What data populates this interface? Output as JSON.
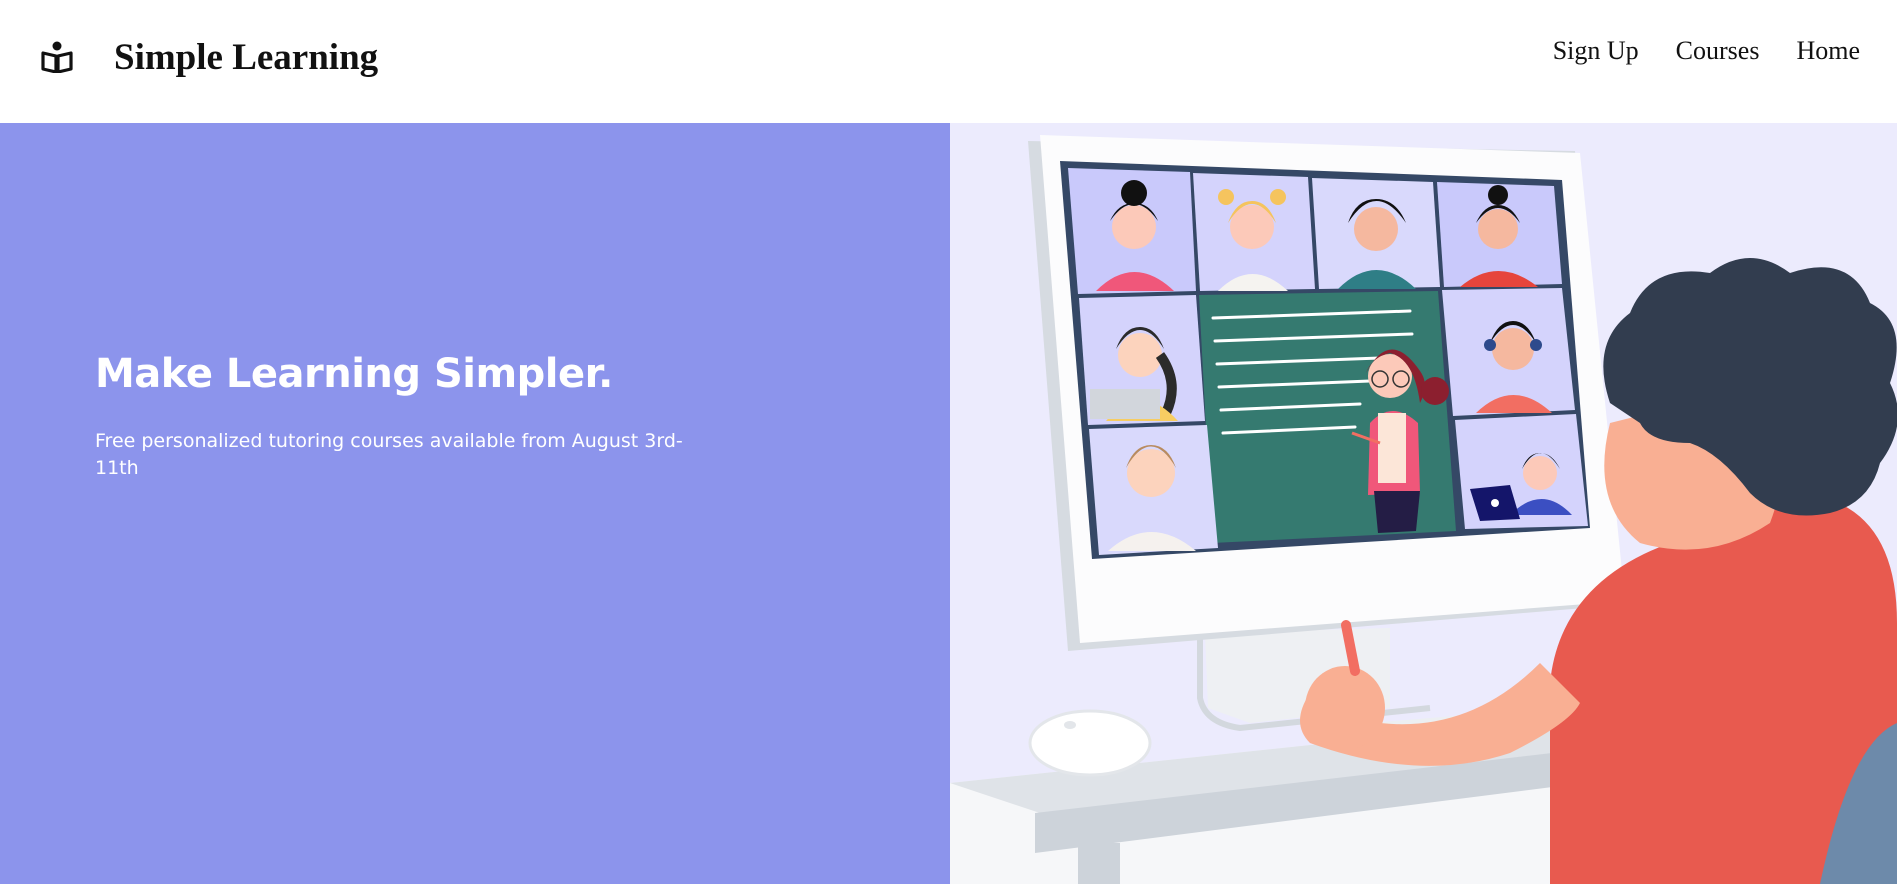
{
  "navbar": {
    "brand": "Simple Learning",
    "logo_icon": "open-book-icon",
    "links": [
      {
        "label": "Sign Up"
      },
      {
        "label": "Courses"
      },
      {
        "label": "Home"
      }
    ]
  },
  "hero": {
    "title_regular": "Make Learning ",
    "title_bold": "Simpler.",
    "subtitle": "Free personalized tutoring courses available from August 3rd-11th",
    "illustration": "online-class-video-call-illustration"
  },
  "colors": {
    "hero_left_bg": "#8c94ec",
    "hero_right_bg": "#ecebfd",
    "teacher_board": "#357a70",
    "shirt_red": "#e85a4f",
    "hair_dark": "#323d4f"
  }
}
